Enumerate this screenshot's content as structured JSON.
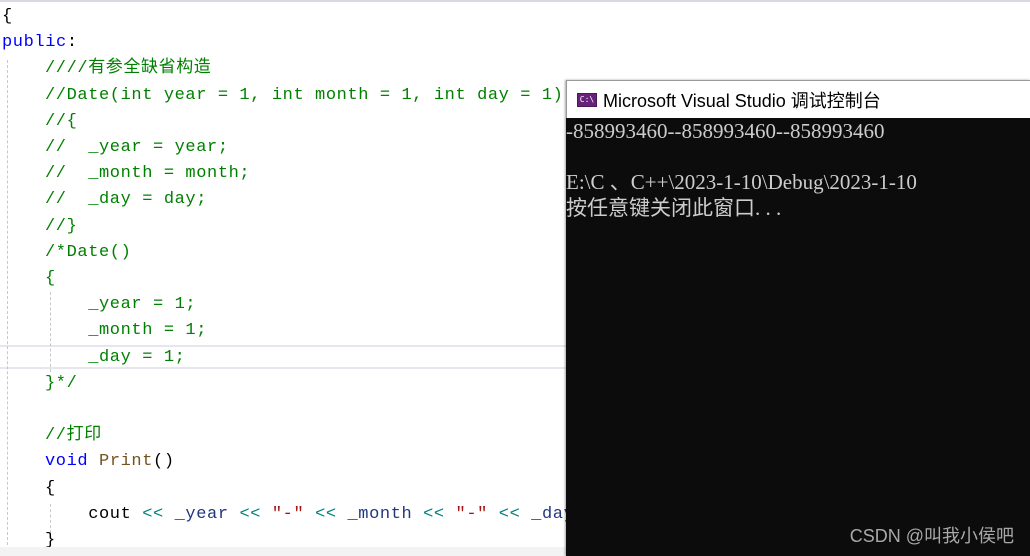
{
  "editor": {
    "lines": [
      {
        "tokens": [
          {
            "c": "plain",
            "t": "{"
          }
        ]
      },
      {
        "tokens": [
          {
            "c": "kw",
            "t": "public"
          },
          {
            "c": "plain",
            "t": ":"
          }
        ]
      },
      {
        "tokens": [
          {
            "c": "cm",
            "t": "////有参全缺省构造"
          }
        ]
      },
      {
        "tokens": [
          {
            "c": "cm",
            "t": "//Date(int year = 1, int month = 1, int day = 1)"
          }
        ]
      },
      {
        "tokens": [
          {
            "c": "cm",
            "t": "//{"
          }
        ]
      },
      {
        "tokens": [
          {
            "c": "cm",
            "t": "//  _year = year;"
          }
        ]
      },
      {
        "tokens": [
          {
            "c": "cm",
            "t": "//  _month = month;"
          }
        ]
      },
      {
        "tokens": [
          {
            "c": "cm",
            "t": "//  _day = day;"
          }
        ]
      },
      {
        "tokens": [
          {
            "c": "cm",
            "t": "//}"
          }
        ]
      },
      {
        "tokens": [
          {
            "c": "cm",
            "t": "/*Date()"
          }
        ]
      },
      {
        "tokens": [
          {
            "c": "cm",
            "t": "{"
          }
        ]
      },
      {
        "tokens": [
          {
            "c": "cm",
            "t": "    _year = 1;"
          }
        ]
      },
      {
        "tokens": [
          {
            "c": "cm",
            "t": "    _month = 1;"
          }
        ]
      },
      {
        "tokens": [
          {
            "c": "cm",
            "t": "    _day = 1;"
          }
        ]
      },
      {
        "tokens": [
          {
            "c": "cm",
            "t": "}*/"
          }
        ]
      },
      {
        "tokens": [
          {
            "c": "plain",
            "t": ""
          }
        ]
      },
      {
        "tokens": [
          {
            "c": "cm",
            "t": "//打印"
          }
        ]
      },
      {
        "tokens": [
          {
            "c": "kw",
            "t": "void"
          },
          {
            "c": "plain",
            "t": " "
          },
          {
            "c": "fn",
            "t": "Print"
          },
          {
            "c": "plain",
            "t": "()"
          }
        ]
      },
      {
        "tokens": [
          {
            "c": "plain",
            "t": "{"
          }
        ]
      },
      {
        "tokens": [
          {
            "c": "plain",
            "t": "    cout "
          },
          {
            "c": "op",
            "t": "<<"
          },
          {
            "c": "var",
            "t": " _year "
          },
          {
            "c": "op",
            "t": "<<"
          },
          {
            "c": "plain",
            "t": " "
          },
          {
            "c": "str",
            "t": "\"-\""
          },
          {
            "c": "plain",
            "t": " "
          },
          {
            "c": "op",
            "t": "<<"
          },
          {
            "c": "var",
            "t": " _month "
          },
          {
            "c": "op",
            "t": "<<"
          },
          {
            "c": "plain",
            "t": " "
          },
          {
            "c": "str",
            "t": "\"-\""
          },
          {
            "c": "plain",
            "t": " "
          },
          {
            "c": "op",
            "t": "<<"
          },
          {
            "c": "var",
            "t": " _day"
          }
        ]
      },
      {
        "tokens": [
          {
            "c": "plain",
            "t": "}"
          }
        ]
      }
    ]
  },
  "console": {
    "title": "Microsoft Visual Studio 调试控制台",
    "icon": "console-app-icon",
    "icon_text": "C:\\",
    "output_lines": [
      "-858993460--858993460--858993460",
      "",
      "E:\\C 、C++\\2023-1-10\\Debug\\2023-1-10",
      "按任意键关闭此窗口. . ."
    ]
  },
  "watermark": "CSDN @叫我小侯吧"
}
